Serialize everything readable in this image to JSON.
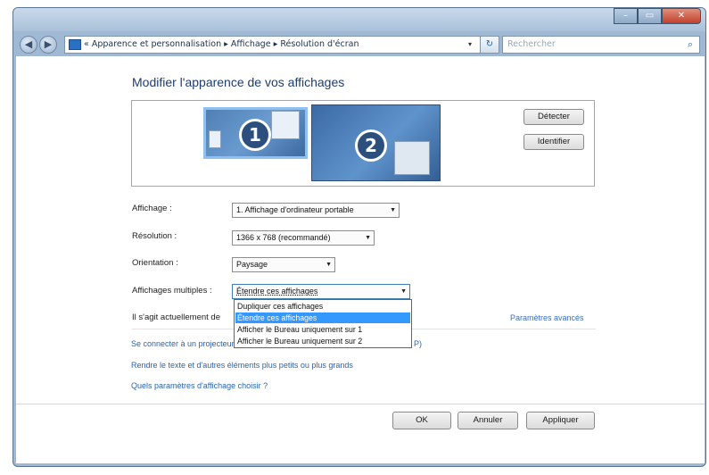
{
  "window": {
    "controls": {
      "minimize": "–",
      "maximize": "▭",
      "close": "✕"
    }
  },
  "navigation": {
    "back": "◀",
    "forward": "▶",
    "breadcrumb": "Apparence et personnalisation  ▸  Affichage  ▸  Résolution d'écran",
    "breadcrumb_prefix": "«",
    "refresh": "↻",
    "search_placeholder": "Rechercher",
    "search_icon": "⌕",
    "dropdown_arrow": "▾"
  },
  "main": {
    "heading": "Modifier l'apparence de vos affichages",
    "monitor1_label": "1",
    "monitor2_label": "2",
    "detect_button": "Détecter",
    "identify_button": "Identifier",
    "fields": {
      "display_label": "Affichage :",
      "display_value": "1. Affichage d'ordinateur portable",
      "resolution_label": "Résolution :",
      "resolution_value": "1366 x 768 (recommandé)",
      "orientation_label": "Orientation :",
      "orientation_value": "Paysage",
      "multiple_label": "Affichages multiples :",
      "multiple_value": "Étendre ces affichages"
    },
    "multiple_options": [
      "Dupliquer ces affichages",
      "Étendre ces affichages",
      "Afficher le Bureau uniquement sur 1",
      "Afficher le Bureau uniquement sur 2"
    ],
    "selected_option_index": 1,
    "current_text": "Il s'agit actuellement de",
    "advanced_link": "Paramètres avancés",
    "links": {
      "projector": "Se connecter à un projecteur",
      "projector_tail": "P)",
      "text_size": "Rendre le texte et d'autres éléments plus petits ou plus grands",
      "which_settings": "Quels paramètres d'affichage choisir ?"
    }
  },
  "footer": {
    "ok": "OK",
    "cancel": "Annuler",
    "apply": "Appliquer"
  }
}
